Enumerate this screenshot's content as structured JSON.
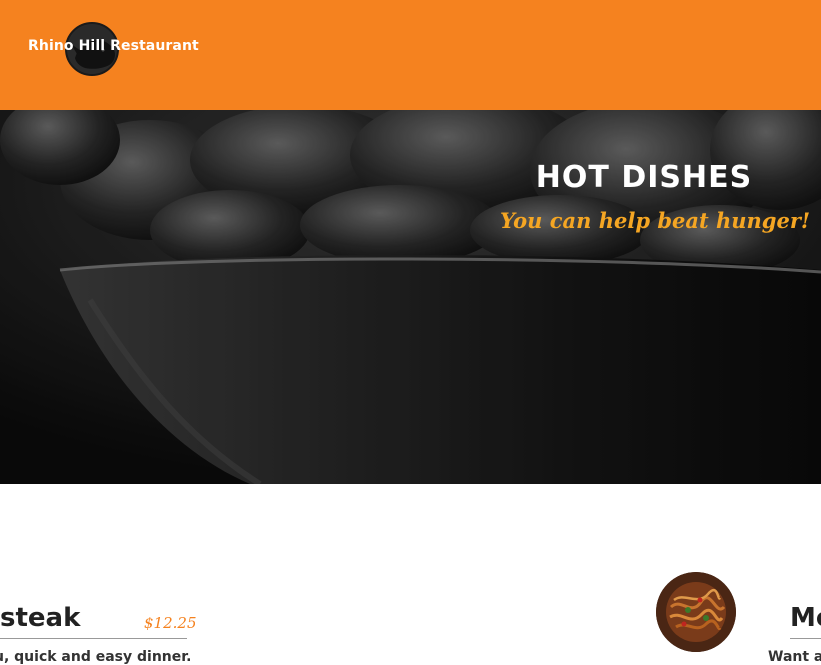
{
  "header": {
    "logo_text": "Rhino Hill Restaurant",
    "logo_icon": "rhino-head-icon",
    "background_color": "#f5821f"
  },
  "hero": {
    "title": "HOT DISHES",
    "subtitle": "You can help beat hunger!",
    "image": "dark-bowl-of-food-photo",
    "subtitle_color": "#f5a623"
  },
  "menu": {
    "left_item": {
      "name": "steak",
      "price": "$12.25",
      "description": "u, quick and easy dinner."
    },
    "right_item": {
      "name": "Me",
      "description": "Want a",
      "image": "noodle-dish-photo"
    }
  }
}
